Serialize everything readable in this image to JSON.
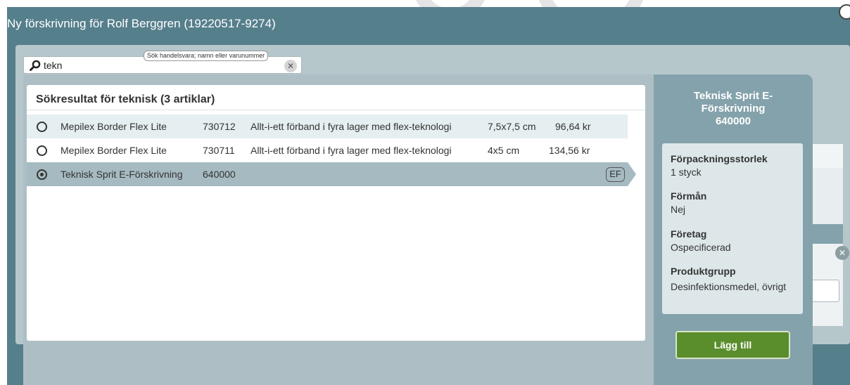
{
  "modal": {
    "title": "Ny förskrivning för Rolf Berggren (19220517-9274)"
  },
  "search": {
    "value": "tekn",
    "tooltip": "Sök handelsvara; namn eller varunummer",
    "icon": "search-icon",
    "clear_icon": "clear-icon"
  },
  "results": {
    "header": "Sökresultat för teknisk (3 artiklar)",
    "rows": [
      {
        "name": "Mepilex Border Flex Lite",
        "number": "730712",
        "description": "Allt-i-ett förband i fyra lager med flex-teknologi",
        "size": "7,5x7,5 cm",
        "price": "96,64 kr",
        "selected": false
      },
      {
        "name": "Mepilex Border Flex Lite",
        "number": "730711",
        "description": "Allt-i-ett förband i fyra lager med flex-teknologi",
        "size": "4x5 cm",
        "price": "134,56 kr",
        "selected": false
      },
      {
        "name": "Teknisk Sprit E-Förskrivning",
        "number": "640000",
        "description": "",
        "size": "",
        "price": "",
        "badge": "EF",
        "selected": true
      }
    ]
  },
  "detail": {
    "title_line1": "Teknisk Sprit E-",
    "title_line2": "Förskrivning",
    "title_line3": "640000",
    "packaging_label": "Förpackningsstorlek",
    "packaging_value": "1 styck",
    "benefit_label": "Förmån",
    "benefit_value": "Nej",
    "company_label": "Företag",
    "company_value": "Ospecificerad",
    "group_label": "Produktgrupp",
    "group_value": "Desinfektionsmedel, övrigt",
    "add_button": "Lägg till"
  },
  "colors": {
    "header_bg": "#567f8c",
    "panel_bg": "#b6c7cc",
    "detail_bg": "#84a2ab",
    "selected_row": "#a6bbc1",
    "button_green": "#5a8d2b"
  }
}
